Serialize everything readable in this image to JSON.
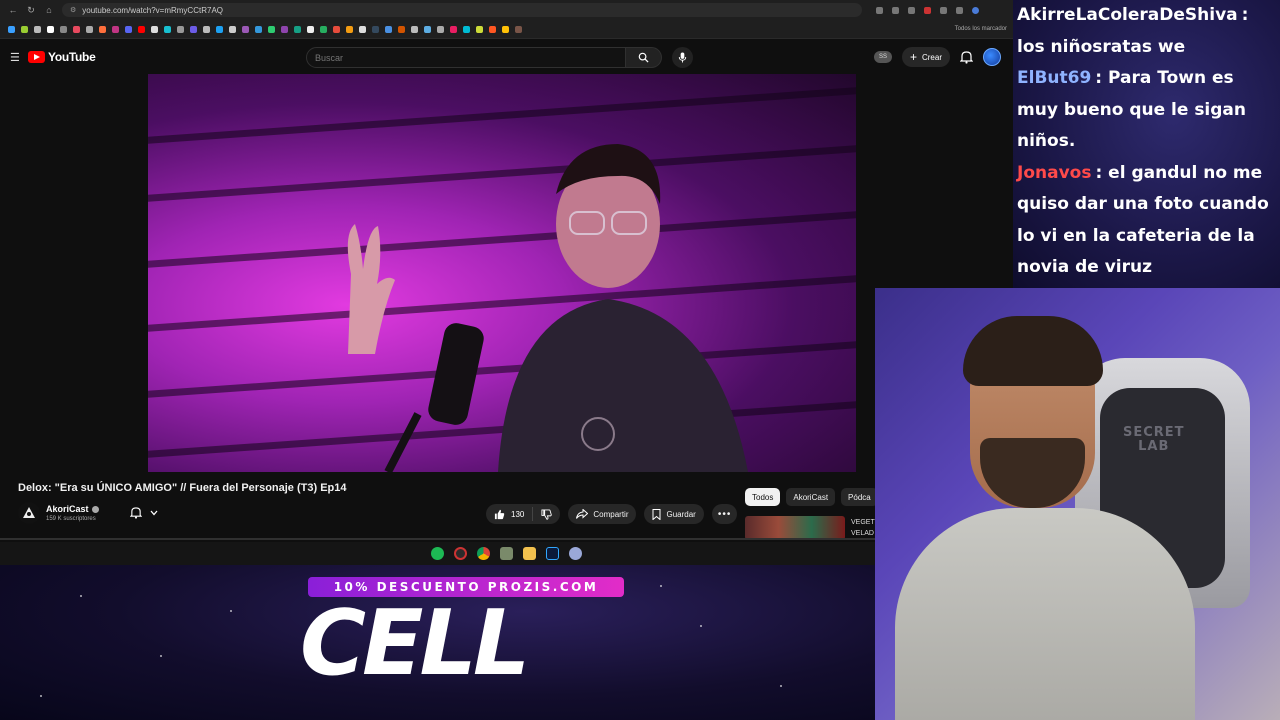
{
  "browser": {
    "url": "youtube.com/watch?v=mRmyCCtR7AQ",
    "bookmarks_folder_label": "Todos los marcador"
  },
  "youtube": {
    "logo_text": "YouTube",
    "search_placeholder": "Buscar",
    "ss_badge": "SS",
    "create_label": "Crear"
  },
  "video": {
    "title": "Delox: \"Era su ÚNICO AMIGO\" // Fuera del Personaje (T3) Ep14",
    "channel_name": "AkoriCast",
    "subscribers": "159 K suscriptores",
    "like_count": "130",
    "share_label": "Compartir",
    "save_label": "Guardar"
  },
  "chips": [
    "Todos",
    "AkoriCast",
    "Pódca"
  ],
  "up_next": {
    "title_line1": "VEGET",
    "title_line2": "VELAD"
  },
  "promo": {
    "tagline": "10% DESCUENTO PROZIS.COM",
    "word": "CELL"
  },
  "chat": [
    {
      "user": "AkirreLaColeraDeShiva",
      "color": "#ffffff",
      "message": ": los niñosratas we"
    },
    {
      "user": "ElBut69",
      "color": "#8fb3ff",
      "message": ": Para Town es muy bueno que le sigan niños."
    },
    {
      "user": "Jonavos",
      "color": "#ff4a4a",
      "message": ": el gandul no me quiso dar una foto cuando lo vi en la cafeteria de la novia de viruz"
    }
  ],
  "webcam": {
    "chair_logo_line1": "SECRET",
    "chair_logo_line2": "LAB"
  },
  "colors": {
    "yt_red": "#ff0000",
    "promo_gradient_start": "#8a1fd8",
    "promo_gradient_end": "#e22cc8"
  }
}
